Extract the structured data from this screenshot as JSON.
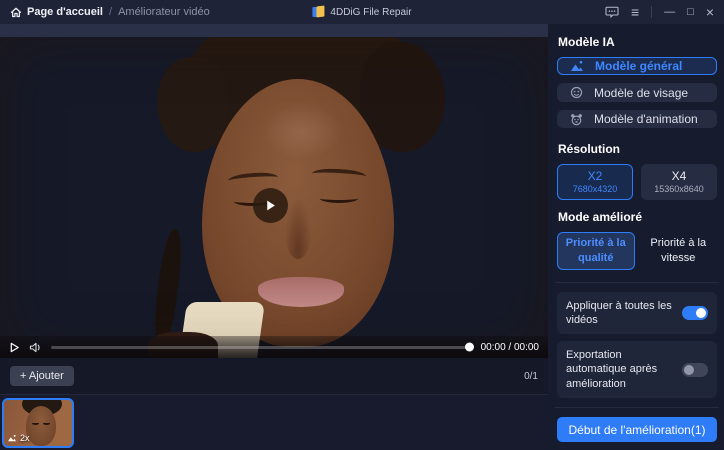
{
  "topbar": {
    "breadcrumb": {
      "home": "Page d'accueil",
      "separator": "/",
      "current": "Améliorateur vidéo"
    },
    "app_title": "4DDiG File Repair",
    "icons": {
      "menu": "≡",
      "minimize": "—",
      "maximize": "□",
      "close": "×"
    }
  },
  "player": {
    "time": "00:00 / 00:00",
    "progress_percent": 100,
    "add_button_label": "+ Ajouter",
    "counter": "0/1",
    "thumbnail_badge": "2x"
  },
  "sidebar": {
    "model_section": {
      "title": "Modèle IA",
      "options": [
        {
          "label": "Modèle général",
          "selected": true
        },
        {
          "label": "Modèle de visage",
          "selected": false
        },
        {
          "label": "Modèle d'animation",
          "selected": false
        }
      ]
    },
    "resolution_section": {
      "title": "Résolution",
      "options": [
        {
          "label": "X2",
          "sublabel": "7680x4320",
          "selected": true
        },
        {
          "label": "X4",
          "sublabel": "15360x8640",
          "selected": false
        }
      ]
    },
    "mode_section": {
      "title": "Mode amélioré",
      "options": [
        {
          "label": "Priorité à la qualité",
          "selected": true
        },
        {
          "label": "Priorité à la vitesse",
          "selected": false
        }
      ]
    },
    "toggles": [
      {
        "label": "Appliquer à toutes les vidéos",
        "on": true
      },
      {
        "label": "Exportation automatique après amélioration",
        "on": false
      }
    ],
    "start_button_label": "Début de l'amélioration(1)"
  },
  "colors": {
    "accent_blue": "#2e7cf6",
    "selected_text": "#3f87ff",
    "sidebar_bg": "#161b2d",
    "topbar_bg": "#1f2337",
    "button_grey": "#262c41",
    "video_bg_brown": "#9b6642"
  }
}
